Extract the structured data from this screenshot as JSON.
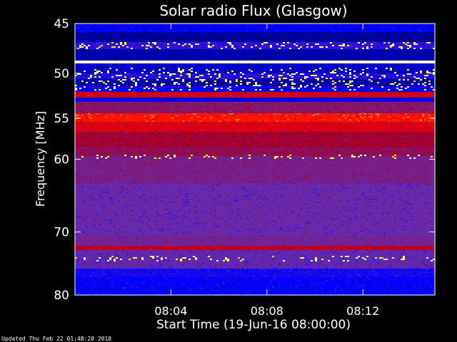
{
  "chart_data": {
    "type": "heatmap",
    "title": "Solar radio Flux (Glasgow)",
    "xlabel": "Start Time (19-Jun-16 08:00:00)",
    "ylabel": "Frequency [MHz]",
    "y_scale": "log",
    "ylim": [
      45,
      80
    ],
    "xlim_minutes": [
      0,
      15
    ],
    "x_ticks": [
      {
        "value": 4,
        "label": "08:04"
      },
      {
        "value": 8,
        "label": "08:08"
      },
      {
        "value": 12,
        "label": "08:12"
      }
    ],
    "y_ticks": [
      {
        "value": 45,
        "label": "45"
      },
      {
        "value": 50,
        "label": "50"
      },
      {
        "value": 55,
        "label": "55"
      },
      {
        "value": 60,
        "label": "60"
      },
      {
        "value": 70,
        "label": "70"
      },
      {
        "value": 80,
        "label": "80"
      }
    ],
    "colormap": [
      "#00008b",
      "#0000ff",
      "#6a2aa8",
      "#a00030",
      "#ff0000",
      "#ffff00",
      "#ffffff"
    ],
    "grid": false,
    "frame_color": "#ffffff"
  },
  "footer": {
    "updated_text": "Updated Thu Feb 22 01:48:20 2018"
  }
}
